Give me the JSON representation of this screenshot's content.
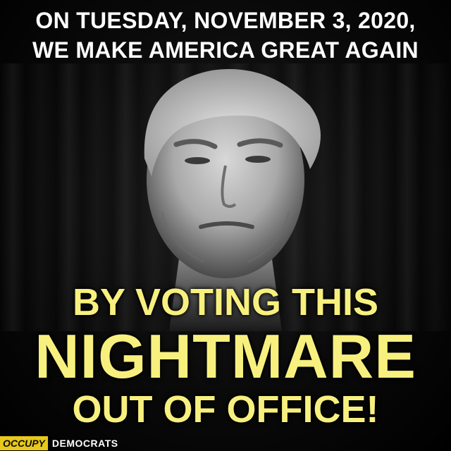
{
  "headline": {
    "line1": "ON TUESDAY, NOVEMBER 3, 2020,",
    "line2": "WE MAKE AMERICA GREAT AGAIN"
  },
  "slogan": {
    "line1": "BY VOTING THIS",
    "line2": "NIGHTMARE",
    "line3": "OUT OF OFFICE!"
  },
  "logo": {
    "box_text": "OCCUPY",
    "word_text": "DEMOCRATS"
  },
  "colors": {
    "background": "#000000",
    "headline": "#ffffff",
    "slogan": "#f7f07e",
    "logo_box": "#e8c81a"
  }
}
